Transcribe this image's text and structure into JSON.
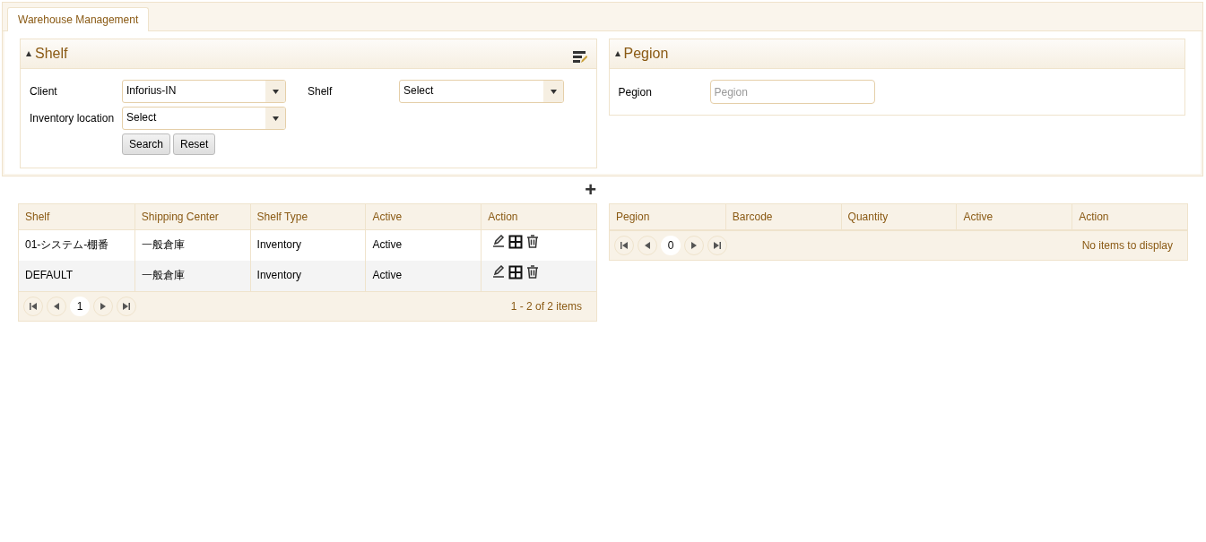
{
  "tabs": [
    {
      "label": "Warehouse Management",
      "selected": true
    }
  ],
  "shelf_panel": {
    "title": "Shelf",
    "expanded": true,
    "fields": [
      {
        "label": "Client",
        "value": "Inforius-IN"
      },
      {
        "label": "Shelf",
        "value": "Select"
      },
      {
        "label": "Inventory location",
        "value": "Select"
      }
    ],
    "buttons": [
      "Search",
      "Reset"
    ]
  },
  "pegion_panel": {
    "title": "Pegion",
    "expanded": true,
    "field": {
      "label": "Pegion",
      "placeholder": "Pegion"
    }
  },
  "add_button": "+",
  "shelf_table": {
    "columns": [
      "Shelf",
      "Shipping Center",
      "Shelf Type",
      "Active",
      "Action"
    ],
    "rows": [
      {
        "cells": [
          "01-システム-棚番",
          "一般倉庫",
          "Inventory",
          "Active"
        ]
      },
      {
        "cells": [
          "DEFAULT",
          "一般倉庫",
          "Inventory",
          "Active"
        ]
      }
    ],
    "page": "1",
    "summary": "1 - 2 of 2 items"
  },
  "pegion_table": {
    "columns": [
      "Pegion",
      "Barcode",
      "Quantity",
      "Active",
      "Action"
    ],
    "page": "0",
    "summary": "No items to display"
  }
}
